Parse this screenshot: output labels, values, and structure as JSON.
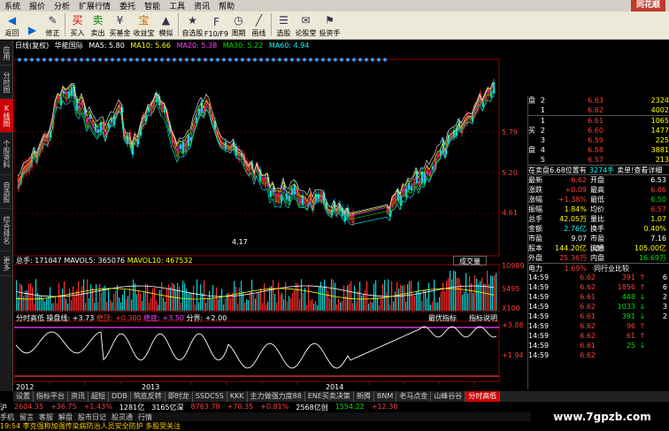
{
  "menu": [
    "系统",
    "报价",
    "分析",
    "扩展行情",
    "委托",
    "智能",
    "工具",
    "资讯",
    "帮助"
  ],
  "logo": "同花顺",
  "toolbar": [
    {
      "label": "返回",
      "icon": "back-icon"
    },
    {
      "label": "",
      "icon": "forward-icon"
    },
    {
      "label": "修正",
      "icon": "edit-icon"
    },
    {
      "label": "买入",
      "icon": "buy-icon"
    },
    {
      "label": "卖出",
      "icon": "sell-icon"
    },
    {
      "label": "买基金",
      "icon": "fund-icon"
    },
    {
      "label": "收益宝",
      "icon": "treasure-icon"
    },
    {
      "label": "模拟",
      "icon": "simulate-icon"
    },
    {
      "label": "自选股",
      "icon": "watchlist-icon"
    },
    {
      "label": "F10/F9",
      "icon": "f10-icon"
    },
    {
      "label": "周期",
      "icon": "period-icon"
    },
    {
      "label": "画线",
      "icon": "draw-icon"
    },
    {
      "label": "选股",
      "icon": "select-stock-icon"
    },
    {
      "label": "论股堂",
      "icon": "forum-icon"
    },
    {
      "label": "投资手",
      "icon": "invest-icon"
    }
  ],
  "left_tabs": [
    {
      "label": "应用",
      "active": false
    },
    {
      "label": "分时图",
      "active": false
    },
    {
      "label": "K线图",
      "active": true
    },
    {
      "label": "个股资料",
      "active": false
    },
    {
      "label": "自选股",
      "active": false
    },
    {
      "label": "综合排名",
      "active": false
    },
    {
      "label": "更多",
      "active": false
    }
  ],
  "kline_header": {
    "period": "日线(复权)",
    "name": "华能国际",
    "ma5": "MA5: 5.80",
    "ma10": "MA10: 5.66",
    "ma20": "MA20: 5.38",
    "ma30": "MA30: 5.22",
    "ma60": "MA60: 4.94"
  },
  "price_axis": [
    "5.79",
    "5.20",
    "4.61"
  ],
  "price_annotation": "4.17",
  "volume_header": {
    "label": "总手: 171047",
    "mavol5": "MAVOL5: 365076",
    "mavol10": "MAVOL10: 467532",
    "button": "成交量"
  },
  "volume_axis": [
    "10989",
    "5495",
    "X100"
  ],
  "indicator_header": {
    "name": "分时高低",
    "pan": "操盘线: +3.73",
    "top": "绝顶: +0.300",
    "bottom": "绝底: +3.50",
    "fen": "分界: +2.00",
    "btn1": "最优指标",
    "btn2": "指标说明"
  },
  "indicator_axis": [
    "+3.88",
    "+1.94"
  ],
  "time_axis": [
    "2012",
    "2013",
    "2014"
  ],
  "orderbook": [
    {
      "level": "2",
      "price": "6.63",
      "vol": "2324"
    },
    {
      "level": "1",
      "price": "6.62",
      "vol": "4002"
    },
    {
      "level": "1",
      "price": "6.61",
      "vol": "1065"
    },
    {
      "level": "2",
      "price": "6.60",
      "vol": "1477"
    },
    {
      "level": "3",
      "price": "6.59",
      "vol": "225"
    },
    {
      "level": "4",
      "price": "6.58",
      "vol": "3881"
    },
    {
      "level": "5",
      "price": "6.57",
      "vol": "213"
    }
  ],
  "orderbook_side_top": "盘",
  "orderbook_side_buy": "买",
  "orderbook_side_bot": "盘",
  "pos_line": {
    "a": "在卖盘6.68位置有",
    "b": "3274手",
    "c": "卖单!查看详细"
  },
  "quote": [
    {
      "a": "最新",
      "b": "6.62",
      "c": "开盘",
      "d": "6.53",
      "bc": "red",
      "dc": "white"
    },
    {
      "a": "涨跌",
      "b": "+0.09",
      "c": "最高",
      "d": "6.66",
      "bc": "red",
      "dc": "red"
    },
    {
      "a": "涨幅",
      "b": "+1.38%",
      "c": "最低",
      "d": "6.50",
      "bc": "red",
      "dc": "green"
    },
    {
      "a": "振幅",
      "b": "1.84%",
      "c": "均价",
      "d": "6.57",
      "bc": "yellow",
      "dc": "red"
    },
    {
      "a": "总手",
      "b": "42.05万",
      "c": "量比",
      "d": "1.07",
      "bc": "yellow",
      "dc": "yellow"
    },
    {
      "a": "金额",
      "b": "2.76亿",
      "c": "换手",
      "d": "0.40%",
      "bc": "cyan",
      "dc": "yellow"
    },
    {
      "a": "市盈",
      "b": "9.07",
      "c": "市盈(动)",
      "d": "7.16",
      "bc": "white",
      "dc": "white"
    },
    {
      "a": "股本",
      "b": "144.20亿",
      "c": "流通",
      "d": "105.00亿",
      "bc": "yellow",
      "dc": "yellow"
    },
    {
      "a": "外盘",
      "b": "25.36万",
      "c": "内盘",
      "d": "16.69万",
      "bc": "red",
      "dc": "green"
    }
  ],
  "sector": {
    "name": "电力",
    "pct": "1.69%",
    "btn": "同行业比较"
  },
  "ticks": [
    {
      "t": "14:59",
      "p": "6.62",
      "v": "391",
      "s": "↑",
      "n": "6",
      "dir": "up"
    },
    {
      "t": "14:59",
      "p": "6.62",
      "v": "1856",
      "s": "↑",
      "n": "6",
      "dir": "up"
    },
    {
      "t": "14:59",
      "p": "6.61",
      "v": "448",
      "s": "↓",
      "n": "2",
      "dir": "down"
    },
    {
      "t": "14:59",
      "p": "6.62",
      "v": "1033",
      "s": "↓",
      "n": "3",
      "dir": "down"
    },
    {
      "t": "14:59",
      "p": "6.61",
      "v": "391",
      "s": "↓",
      "n": "2",
      "dir": "down"
    },
    {
      "t": "14:59",
      "p": "6.62",
      "v": "96",
      "s": "↑",
      "n": "",
      "dir": "up"
    },
    {
      "t": "14:59",
      "p": "6.62",
      "v": "61",
      "s": "↑",
      "n": "",
      "dir": "up"
    },
    {
      "t": "14:59",
      "p": "6.61",
      "v": "25",
      "s": "↓",
      "n": "",
      "dir": "down"
    },
    {
      "t": "14:59",
      "p": "6.62",
      "v": "",
      "s": "",
      "n": "",
      "dir": "up"
    }
  ],
  "bottom_tabs": [
    {
      "label": "设置",
      "active": false
    },
    {
      "label": "指标平台",
      "active": false
    },
    {
      "label": "资讯",
      "active": false
    },
    {
      "label": "超短",
      "active": false
    },
    {
      "label": "DDB",
      "active": false
    },
    {
      "label": "筑底反转",
      "active": false
    },
    {
      "label": "即时龙",
      "active": false
    },
    {
      "label": "SSDC5S",
      "active": false
    },
    {
      "label": "KKK",
      "active": false
    },
    {
      "label": "主力做强力度88",
      "active": false
    },
    {
      "label": "ENE买卖决策",
      "active": false
    },
    {
      "label": "新腾",
      "active": false
    },
    {
      "label": "BNM",
      "active": false
    },
    {
      "label": "老马点金",
      "active": false
    },
    {
      "label": "山峰谷谷",
      "active": false
    },
    {
      "label": "分时高低",
      "active": true
    }
  ],
  "index_bar": [
    {
      "text": "沪",
      "c": "white"
    },
    {
      "text": "2604.35",
      "c": "red"
    },
    {
      "text": "+36.75",
      "c": "red"
    },
    {
      "text": "+1.43%",
      "c": "red"
    },
    {
      "text": "1281亿",
      "c": "white"
    },
    {
      "text": "3165亿深",
      "c": "white"
    },
    {
      "text": "8763.78",
      "c": "red"
    },
    {
      "text": "+70.35",
      "c": "red"
    },
    {
      "text": "+0.81%",
      "c": "red"
    },
    {
      "text": "2568亿创",
      "c": "white"
    },
    {
      "text": "1554.22",
      "c": "green"
    },
    {
      "text": "+12.30",
      "c": "red"
    }
  ],
  "status_bar": [
    "手机",
    "留言",
    "客服",
    "解盘",
    "股市日记",
    "股灵通",
    "行情"
  ],
  "news": "19:54 李克强称加强传染病防治人员安全防护 多股受关注",
  "watermark": "www.7gpzb.com"
}
